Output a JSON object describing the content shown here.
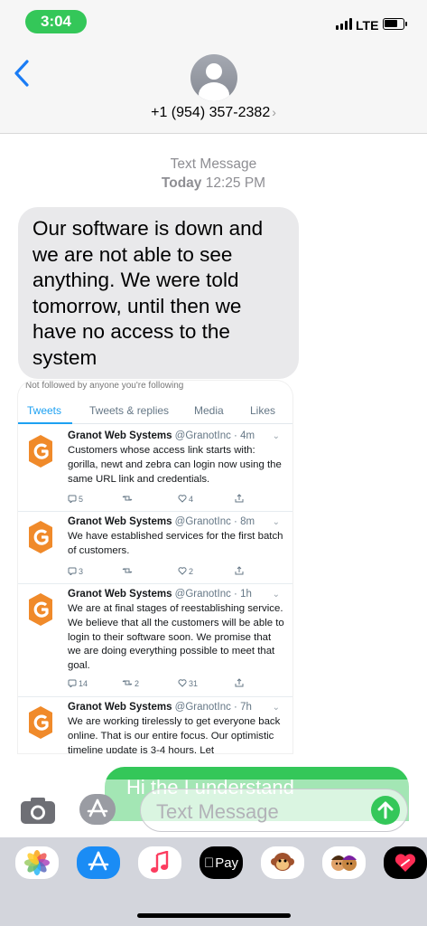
{
  "status": {
    "time": "3:04",
    "network": "LTE",
    "battery_level": 0.75
  },
  "header": {
    "contact": "+1 (954) 357-2382",
    "chevron": "›"
  },
  "thread": {
    "label": "Text Message",
    "day": "Today",
    "time": "12:25 PM",
    "received_text": "Our software is down and we are not able to see anything. We were told tomorrow,  until then we have no access to the system"
  },
  "twitter": {
    "note": "Not followed by anyone you're following",
    "tabs": [
      "Tweets",
      "Tweets & replies",
      "Media",
      "Likes"
    ],
    "tweets": [
      {
        "name": "Granot Web Systems",
        "handle": "@GranotInc",
        "time": "· 4m",
        "text": "Customers whose access link starts with: gorilla, newt and zebra can login now using the same URL link and credentials.",
        "replies": "5",
        "retweets": "",
        "likes": "4"
      },
      {
        "name": "Granot Web Systems",
        "handle": "@GranotInc",
        "time": "· 8m",
        "text": "We have established services for the first batch of customers.",
        "replies": "3",
        "retweets": "",
        "likes": "2"
      },
      {
        "name": "Granot Web Systems",
        "handle": "@GranotInc",
        "time": "· 1h",
        "text": "We are at final stages of reestablishing service. We believe that all the customers will be able to login to their software soon. We promise that we are doing everything possible to meet that goal.",
        "replies": "14",
        "retweets": "2",
        "likes": "31"
      },
      {
        "name": "Granot Web Systems",
        "handle": "@GranotInc",
        "time": "· 7h",
        "text": "We are working tirelessly to get everyone back online. That is our entire focus. Our optimistic timeline update is 3-4 hours. Let",
        "replies": "",
        "retweets": "",
        "likes": ""
      }
    ]
  },
  "sent_partial": "Hi the  I      understand     ",
  "composer": {
    "placeholder": "Text Message"
  },
  "apps": [
    {
      "name": "photos-app-icon"
    },
    {
      "name": "app-store-app-icon"
    },
    {
      "name": "music-app-icon"
    },
    {
      "name": "apple-pay-app-icon",
      "label": "Pay"
    },
    {
      "name": "monkey-memoji-app-icon"
    },
    {
      "name": "memoji-app-icon"
    },
    {
      "name": "digital-touch-app-icon"
    }
  ],
  "colors": {
    "imessage_green": "#34c759",
    "twitter_blue": "#1da1f2",
    "granot_orange": "#f08a2a"
  }
}
